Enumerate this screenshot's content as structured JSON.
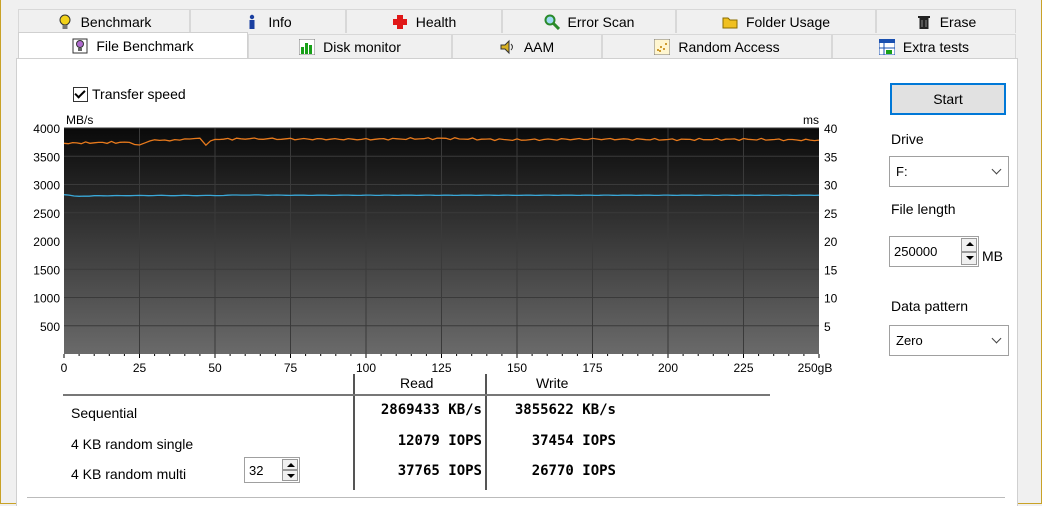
{
  "tabs_top": [
    {
      "label": "Benchmark",
      "icon": "bulb-icon"
    },
    {
      "label": "Info",
      "icon": "info-icon"
    },
    {
      "label": "Health",
      "icon": "health-cross-icon"
    },
    {
      "label": "Error Scan",
      "icon": "magnifier-icon"
    },
    {
      "label": "Folder Usage",
      "icon": "folder-icon"
    },
    {
      "label": "Erase",
      "icon": "trash-icon"
    }
  ],
  "tabs_bottom": [
    {
      "label": "File Benchmark",
      "icon": "file-benchmark-icon",
      "active": true
    },
    {
      "label": "Disk monitor",
      "icon": "bar-chart-icon"
    },
    {
      "label": "AAM",
      "icon": "speaker-icon"
    },
    {
      "label": "Random Access",
      "icon": "scatter-icon"
    },
    {
      "label": "Extra tests",
      "icon": "table-icon"
    }
  ],
  "transfer_speed_label": "Transfer speed",
  "chart": {
    "y_left_unit": "MB/s",
    "y_right_unit": "ms",
    "y_left_ticks": [
      "4000",
      "3500",
      "3000",
      "2500",
      "2000",
      "1500",
      "1000",
      "500"
    ],
    "y_right_ticks": [
      "40",
      "35",
      "30",
      "25",
      "20",
      "15",
      "10",
      "5"
    ],
    "x_ticks": [
      "0",
      "25",
      "50",
      "75",
      "100",
      "125",
      "150",
      "175",
      "200",
      "225",
      "250gB"
    ]
  },
  "chart_data": {
    "type": "line",
    "xlabel": "",
    "ylabel": "MB/s",
    "xlim": [
      0,
      250
    ],
    "ylim": [
      0,
      4000
    ],
    "y2lim": [
      0,
      40
    ],
    "series": [
      {
        "x": [
          0,
          10,
          20,
          25,
          27,
          30,
          35,
          40,
          45,
          47,
          50,
          60,
          75,
          100,
          125,
          150,
          175,
          200,
          225,
          250
        ],
        "values": [
          3730,
          3740,
          3745,
          3690,
          3730,
          3800,
          3790,
          3800,
          3805,
          3710,
          3800,
          3810,
          3805,
          3800,
          3815,
          3790,
          3805,
          3795,
          3800,
          3785
        ],
        "color": "#e87a1c"
      },
      {
        "x": [
          0,
          5,
          10,
          25,
          50,
          60,
          75,
          100,
          150,
          200,
          250
        ],
        "values": [
          2820,
          2790,
          2800,
          2805,
          2805,
          2815,
          2810,
          2810,
          2810,
          2810,
          2810
        ],
        "color": "#3aa8d8"
      }
    ]
  },
  "start_label": "Start",
  "drive_label": "Drive",
  "drive_value": "F:",
  "file_length_label": "File length",
  "file_length_value": "250000",
  "file_length_unit": "MB",
  "data_pattern_label": "Data pattern",
  "data_pattern_value": "Zero",
  "results": {
    "read_header": "Read",
    "write_header": "Write",
    "rows": [
      {
        "label": "Sequential",
        "read": "2869433 KB/s",
        "write": "3855622 KB/s"
      },
      {
        "label": "4 KB random single",
        "read": "12079 IOPS",
        "write": "37454 IOPS"
      },
      {
        "label": "4 KB random multi",
        "read": "37765 IOPS",
        "write": "26770 IOPS"
      }
    ],
    "queue_depth": "32"
  },
  "colors": {
    "read": "#3aa8d8",
    "write": "#e87a1c",
    "accent": "#0078d7"
  }
}
